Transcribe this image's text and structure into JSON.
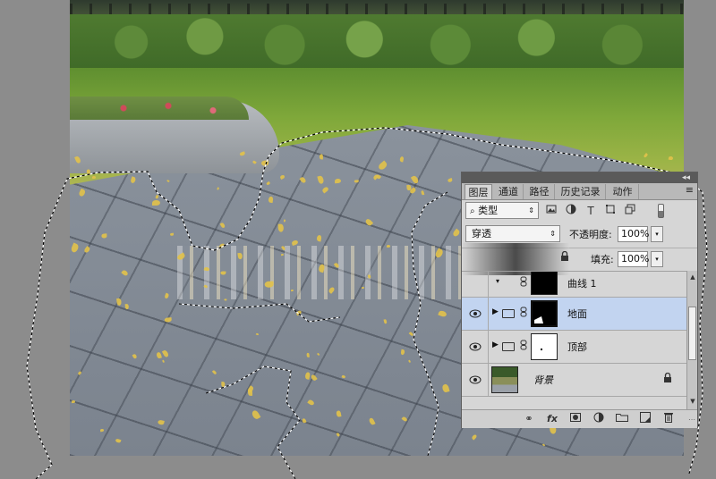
{
  "tabs": [
    {
      "label": "图层",
      "active": true
    },
    {
      "label": "通道",
      "active": false
    },
    {
      "label": "路径",
      "active": false
    },
    {
      "label": "历史记录",
      "active": false
    },
    {
      "label": "动作",
      "active": false
    }
  ],
  "panel_menu_icon": "≡",
  "collapse_icon": "◂◂",
  "filter": {
    "icon": "⌕",
    "label": "类型",
    "arrows": "⇕"
  },
  "filter_icons": [
    "image-filter-icon",
    "adjustment-filter-icon",
    "type-filter-icon",
    "shape-filter-icon",
    "smart-object-filter-icon"
  ],
  "blend_mode": {
    "value": "穿透",
    "arrows": "⇕"
  },
  "opacity": {
    "label": "不透明度:",
    "value": "100%"
  },
  "fill": {
    "label": "填充:",
    "value": "100%"
  },
  "dropdown_glyph": "▾",
  "layers": [
    {
      "name": "曲线 1",
      "visible": false,
      "selected": false,
      "type": "adjustment"
    },
    {
      "name": "地面",
      "visible": true,
      "selected": true,
      "type": "group"
    },
    {
      "name": "顶部",
      "visible": true,
      "selected": false,
      "type": "group"
    },
    {
      "name": "背景",
      "visible": true,
      "selected": false,
      "type": "background"
    }
  ],
  "footer_icons": [
    "link-layers-icon",
    "layer-style-icon",
    "add-mask-icon",
    "adjustment-layer-icon",
    "new-group-icon",
    "new-layer-icon",
    "delete-layer-icon"
  ],
  "colors": {
    "selected_row": "#c2d4f0",
    "panel_bg": "#d6d6d6",
    "workspace": "#8c8c8c"
  }
}
